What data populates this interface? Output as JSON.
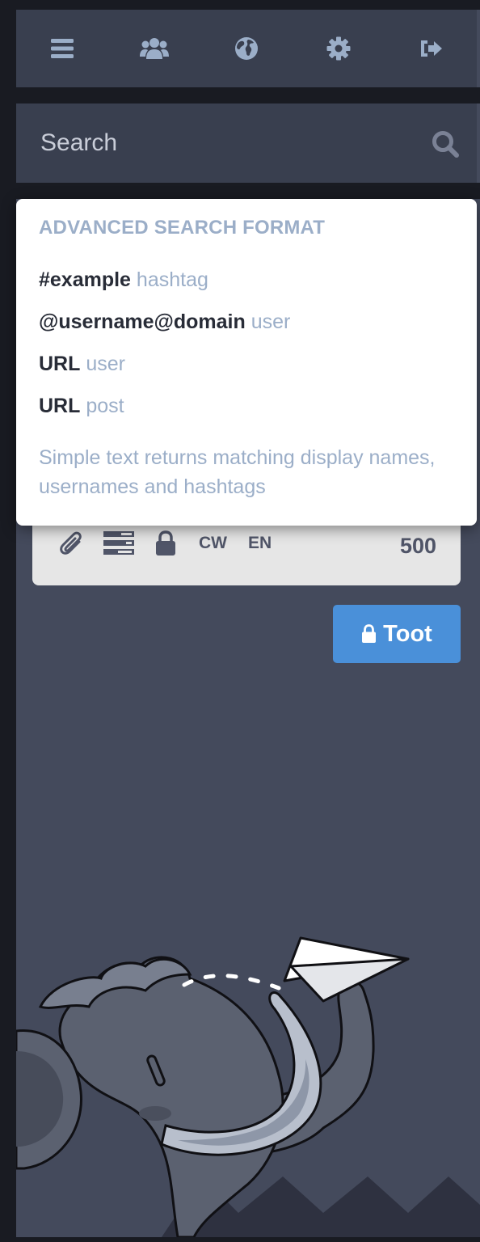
{
  "navbar": {
    "items": [
      {
        "icon": "bars-icon",
        "label": "Getting started"
      },
      {
        "icon": "users-icon",
        "label": "Local timeline"
      },
      {
        "icon": "globe-icon",
        "label": "Federated timeline"
      },
      {
        "icon": "gear-icon",
        "label": "Preferences"
      },
      {
        "icon": "sign-out-icon",
        "label": "Logout"
      }
    ]
  },
  "search": {
    "placeholder": "Search",
    "value": "",
    "icon": "search-icon"
  },
  "popover": {
    "title": "ADVANCED SEARCH FORMAT",
    "rows": [
      {
        "term": "#example",
        "kind": "hashtag"
      },
      {
        "term": "@username@domain",
        "kind": "user"
      },
      {
        "term": "URL",
        "kind": "user"
      },
      {
        "term": "URL",
        "kind": "post"
      }
    ],
    "hint": "Simple text returns matching display names, usernames and hashtags"
  },
  "composer": {
    "tools": [
      {
        "icon": "paperclip-icon"
      },
      {
        "icon": "poll-icon"
      },
      {
        "icon": "lock-icon"
      }
    ],
    "cw_label": "CW",
    "language_label": "EN",
    "char_count": "500"
  },
  "toot_button": {
    "label": "Toot",
    "icon": "lock-icon"
  },
  "colors": {
    "accent": "#4a90d9",
    "panel": "#393f4f",
    "background": "#444a5c",
    "muted_text": "#9baec8"
  }
}
